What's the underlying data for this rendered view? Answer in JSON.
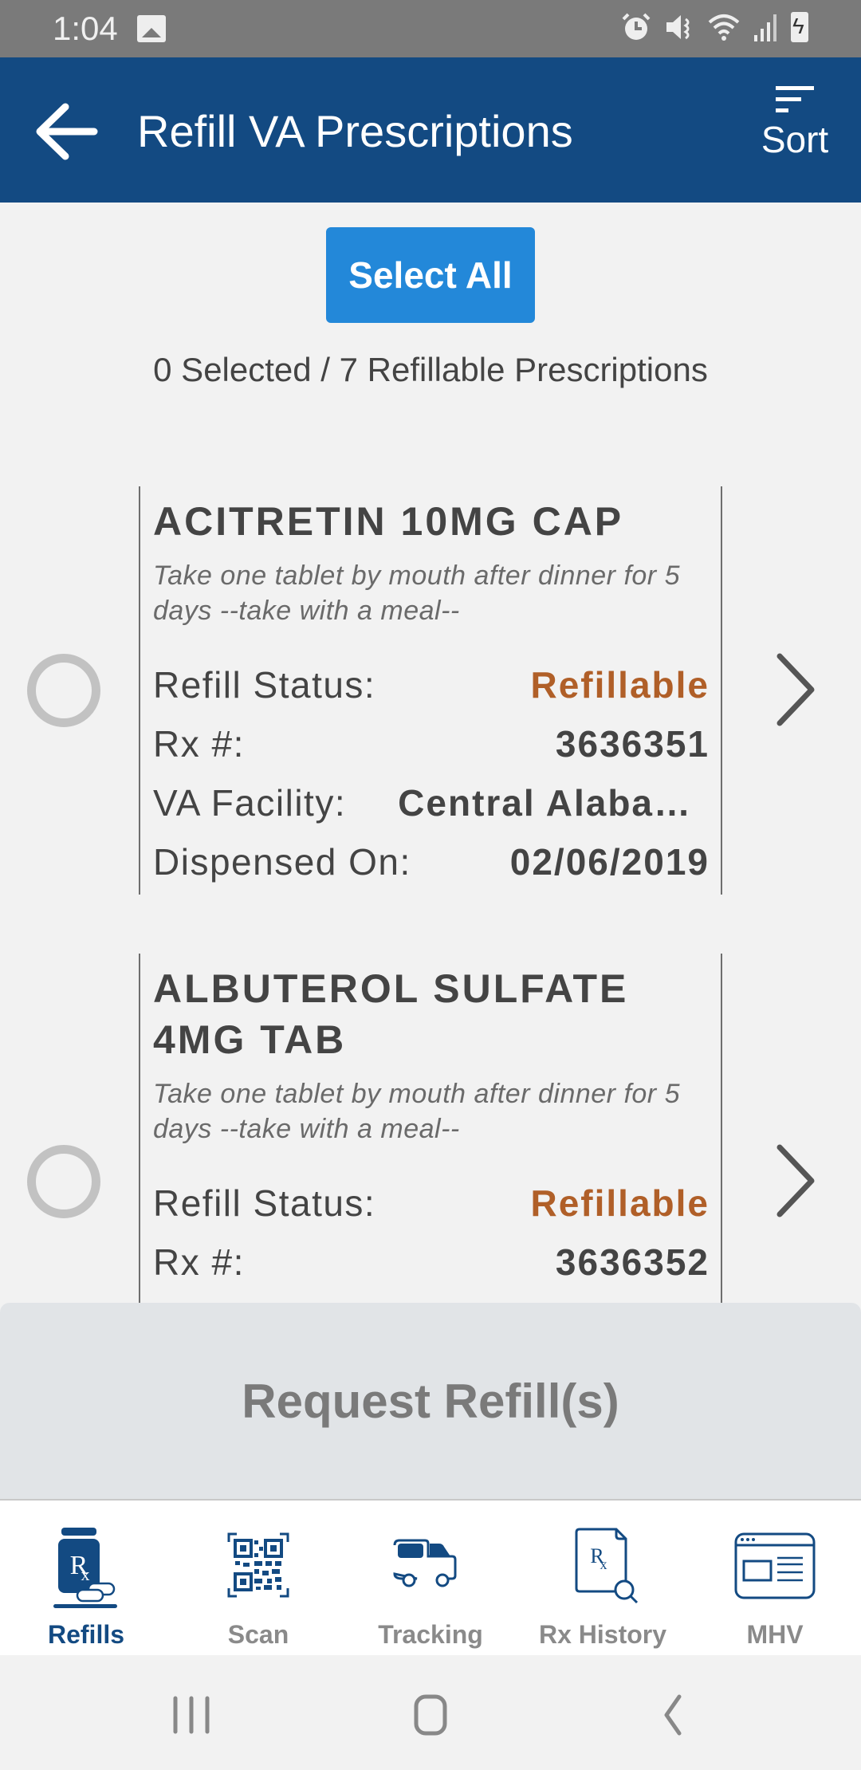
{
  "status_bar": {
    "time": "1:04",
    "icons": [
      "image-icon",
      "alarm-icon",
      "mute-icon",
      "wifi-icon",
      "signal-icon",
      "battery-charging-icon"
    ]
  },
  "app_bar": {
    "title": "Refill VA Prescriptions",
    "back_icon": "arrow-left-icon",
    "sort_label": "Sort",
    "sort_icon": "sort-icon"
  },
  "selection": {
    "select_all_label": "Select All",
    "count_text": "0 Selected / 7 Refillable Prescriptions",
    "selected": 0,
    "total": 7
  },
  "labels": {
    "refill_status": "Refill Status:",
    "rx_number": "Rx #:",
    "va_facility": "VA Facility:",
    "dispensed_on": "Dispensed On:"
  },
  "prescriptions": [
    {
      "name": "ACITRETIN 10MG CAP",
      "sig": "Take one tablet by mouth after dinner for 5 days --take with a meal--",
      "refill_status": "Refillable",
      "rx_number": "3636351",
      "va_facility": "Central Alaba…",
      "dispensed_on": "02/06/2019",
      "selected": false
    },
    {
      "name": "ALBUTEROL SULFATE 4MG TAB",
      "sig": "Take one tablet by mouth after dinner for 5 days --take with a meal--",
      "refill_status": "Refillable",
      "rx_number": "3636352",
      "selected": false
    }
  ],
  "footer": {
    "request_label": "Request Refill(s)"
  },
  "tabs": [
    {
      "label": "Refills",
      "icon": "rx-bottle-icon",
      "active": true
    },
    {
      "label": "Scan",
      "icon": "qr-code-icon",
      "active": false
    },
    {
      "label": "Tracking",
      "icon": "truck-icon",
      "active": false
    },
    {
      "label": "Rx History",
      "icon": "rx-document-search-icon",
      "active": false
    },
    {
      "label": "MHV",
      "icon": "browser-window-icon",
      "active": false
    }
  ],
  "colors": {
    "brand": "#134a82",
    "accent": "#2388d9",
    "status_refillable": "#b05f28"
  }
}
